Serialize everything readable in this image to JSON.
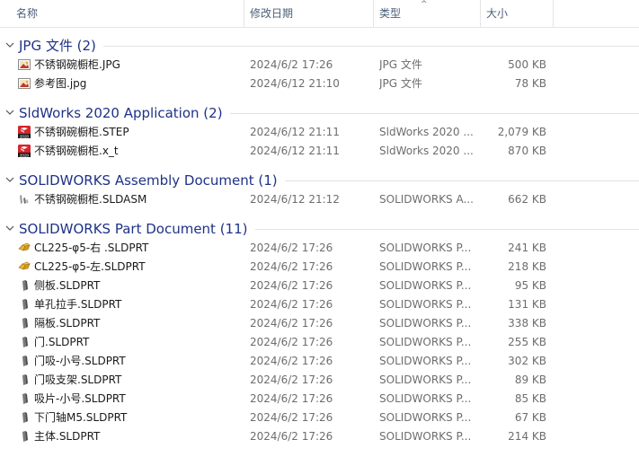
{
  "columns": {
    "name": "名称",
    "date": "修改日期",
    "type": "类型",
    "size": "大小",
    "sort_indicator": "^"
  },
  "groups": [
    {
      "title": "JPG 文件 (2)",
      "files": [
        {
          "name": "不锈钢碗橱柜.JPG",
          "date": "2024/6/2 17:26",
          "type": "JPG 文件",
          "size": "500 KB",
          "icon": "jpg-image-icon"
        },
        {
          "name": "参考图.jpg",
          "date": "2024/6/12 21:10",
          "type": "JPG 文件",
          "size": "78 KB",
          "icon": "jpg-image-icon"
        }
      ]
    },
    {
      "title": "SldWorks 2020 Application (2)",
      "files": [
        {
          "name": "不锈钢碗橱柜.STEP",
          "date": "2024/6/12 21:11",
          "type": "SldWorks 2020 ...",
          "size": "2,079 KB",
          "icon": "sldworks-2020-icon"
        },
        {
          "name": "不锈钢碗橱柜.x_t",
          "date": "2024/6/12 21:11",
          "type": "SldWorks 2020 ...",
          "size": "870 KB",
          "icon": "sldworks-2020-icon"
        }
      ]
    },
    {
      "title": "SOLIDWORKS Assembly Document (1)",
      "files": [
        {
          "name": "不锈钢碗橱柜.SLDASM",
          "date": "2024/6/12 21:12",
          "type": "SOLIDWORKS A...",
          "size": "662 KB",
          "icon": "assembly-thumbnail-icon"
        }
      ]
    },
    {
      "title": "SOLIDWORKS Part Document (11)",
      "files": [
        {
          "name": "CL225-φ5-右 .SLDPRT",
          "date": "2024/6/2 17:26",
          "type": "SOLIDWORKS P...",
          "size": "241 KB",
          "icon": "part-thumbnail-icon"
        },
        {
          "name": "CL225-φ5-左.SLDPRT",
          "date": "2024/6/2 17:26",
          "type": "SOLIDWORKS P...",
          "size": "218 KB",
          "icon": "part-thumbnail-icon"
        },
        {
          "name": "侧板.SLDPRT",
          "date": "2024/6/2 17:26",
          "type": "SOLIDWORKS P...",
          "size": "95 KB",
          "icon": "part-thumbnail-icon"
        },
        {
          "name": "单孔拉手.SLDPRT",
          "date": "2024/6/2 17:26",
          "type": "SOLIDWORKS P...",
          "size": "131 KB",
          "icon": "part-thumbnail-icon"
        },
        {
          "name": "隔板.SLDPRT",
          "date": "2024/6/2 17:26",
          "type": "SOLIDWORKS P...",
          "size": "338 KB",
          "icon": "part-thumbnail-icon"
        },
        {
          "name": "门.SLDPRT",
          "date": "2024/6/2 17:26",
          "type": "SOLIDWORKS P...",
          "size": "255 KB",
          "icon": "part-thumbnail-icon"
        },
        {
          "name": "门吸-小号.SLDPRT",
          "date": "2024/6/2 17:26",
          "type": "SOLIDWORKS P...",
          "size": "302 KB",
          "icon": "part-thumbnail-icon"
        },
        {
          "name": "门吸支架.SLDPRT",
          "date": "2024/6/2 17:26",
          "type": "SOLIDWORKS P...",
          "size": "89 KB",
          "icon": "part-thumbnail-icon"
        },
        {
          "name": "吸片-小号.SLDPRT",
          "date": "2024/6/2 17:26",
          "type": "SOLIDWORKS P...",
          "size": "85 KB",
          "icon": "part-thumbnail-icon"
        },
        {
          "name": "下门轴M5.SLDPRT",
          "date": "2024/6/2 17:26",
          "type": "SOLIDWORKS P...",
          "size": "67 KB",
          "icon": "part-thumbnail-icon"
        },
        {
          "name": "主体.SLDPRT",
          "date": "2024/6/2 17:26",
          "type": "SOLIDWORKS P...",
          "size": "214 KB",
          "icon": "part-thumbnail-icon"
        }
      ]
    }
  ]
}
